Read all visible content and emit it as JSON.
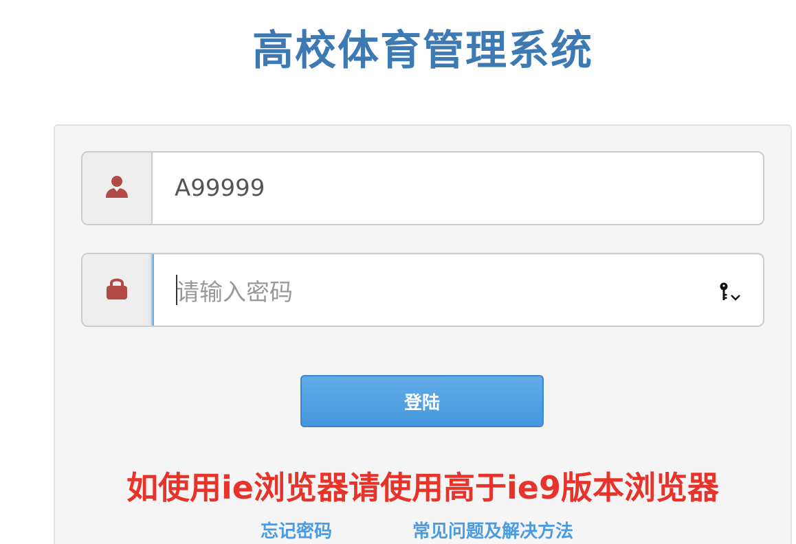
{
  "header": {
    "title": "高校体育管理系统"
  },
  "login_form": {
    "username": {
      "value": "A99999",
      "icon": "user-icon"
    },
    "password": {
      "value": "",
      "placeholder": "请输入密码",
      "icon": "lock-icon",
      "keychain_icon": "key-icon"
    },
    "submit_label": "登陆"
  },
  "notice": "如使用ie浏览器请使用高于ie9版本浏览器",
  "links": {
    "forgot_password": "忘记密码",
    "faq": "常见问题及解决方法"
  },
  "colors": {
    "title": "#3d7ab4",
    "icon": "#b14a45",
    "button": "#4a9be0",
    "notice": "#e8332b",
    "link": "#4a9be0"
  }
}
